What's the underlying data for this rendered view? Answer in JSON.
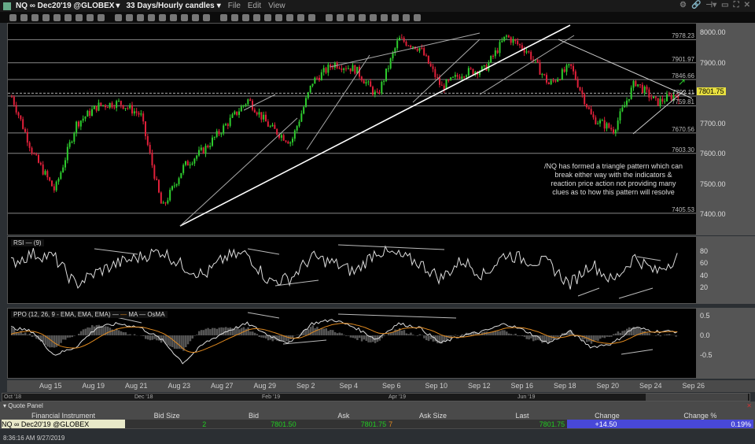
{
  "window": {
    "symbol": "NQ ∞ Dec20'19 @GLOBEX",
    "timeframe": "33 Days/Hourly candles",
    "menus": [
      "File",
      "Edit",
      "View"
    ]
  },
  "price_axis": {
    "ticks": [
      "8000.00",
      "7900.00",
      "7800.00",
      "7700.00",
      "7600.00",
      "7500.00",
      "7400.00"
    ],
    "last_price": "7801.75",
    "last_color": "#e8e040"
  },
  "levels": [
    "7978.23",
    "7901.97",
    "7846.66",
    "7792.11",
    "7759.81",
    "7670.56",
    "7603.30",
    "7405.53"
  ],
  "annotation": "/NQ has formed a triangle pattern which can break either way with the indicators & reaction price action not providing many clues as to how this pattern will resolve",
  "rsi": {
    "label": "RSI",
    "params": "(9)",
    "ticks": [
      "80",
      "60",
      "40",
      "20"
    ]
  },
  "ppo": {
    "label": "PPO",
    "params": "(12, 26, 9 - EMA, EMA, EMA)",
    "ma": "MA",
    "osma": "OsMA",
    "ticks": [
      "0.5",
      "0.0",
      "-0.5"
    ],
    "ma_color": "#e08a20"
  },
  "dates": [
    "Aug 15",
    "Aug 19",
    "Aug 21",
    "Aug 23",
    "Aug 27",
    "Aug 29",
    "Sep 2",
    "Sep 4",
    "Sep 6",
    "Sep 10",
    "Sep 12",
    "Sep 16",
    "Sep 18",
    "Sep 20",
    "Sep 24",
    "Sep 26"
  ],
  "overview_dates": [
    "Oct '18",
    "Dec '18",
    "Feb '19",
    "Apr '19",
    "Jun '19",
    "Aug '19"
  ],
  "quote_panel": {
    "title": "Quote Panel",
    "headers": [
      "Financial Instrument",
      "Bid Size",
      "Bid",
      "Ask",
      "Ask Size",
      "Last",
      "Change",
      "Change %"
    ],
    "row": {
      "instrument": "NQ ∞ Dec20'19 @GLOBEX",
      "bid_size": "2",
      "bid": "7801.50",
      "ask": "7801.75",
      "ask_size": "7",
      "last": "7801.75",
      "change": "+14.50",
      "change_pct": "0.19%"
    },
    "change_bg": "#4848d8"
  },
  "status": {
    "time": "8:36:16 AM 9/27/2019"
  },
  "chart_data": {
    "type": "candlestick",
    "ylim": [
      7350,
      8020
    ],
    "approx_close_path": [
      7790,
      7600,
      7480,
      7700,
      7760,
      7770,
      7730,
      7420,
      7560,
      7620,
      7700,
      7780,
      7690,
      7640,
      7840,
      7900,
      7880,
      7790,
      7980,
      7950,
      7820,
      7870,
      7880,
      7990,
      7940,
      7830,
      7890,
      7720,
      7680,
      7840,
      7770,
      7801.75
    ],
    "rsi_path": [
      60,
      75,
      70,
      25,
      45,
      60,
      70,
      80,
      55,
      40,
      70,
      75,
      30,
      35,
      70,
      60,
      45,
      80,
      72,
      60,
      35,
      65,
      40,
      75,
      65,
      60,
      25,
      60,
      30,
      70,
      45,
      70
    ],
    "ppo_path": [
      0.2,
      0.1,
      -0.5,
      -0.3,
      0.2,
      0.3,
      0.2,
      -0.1,
      -0.7,
      -0.2,
      0.1,
      0.3,
      0.0,
      -0.2,
      0.3,
      0.4,
      0.2,
      -0.1,
      0.3,
      0.2,
      -0.2,
      0.0,
      0.1,
      0.3,
      0.1,
      -0.2,
      0.1,
      -0.3,
      -0.2,
      0.2,
      0.1,
      0.1
    ]
  }
}
